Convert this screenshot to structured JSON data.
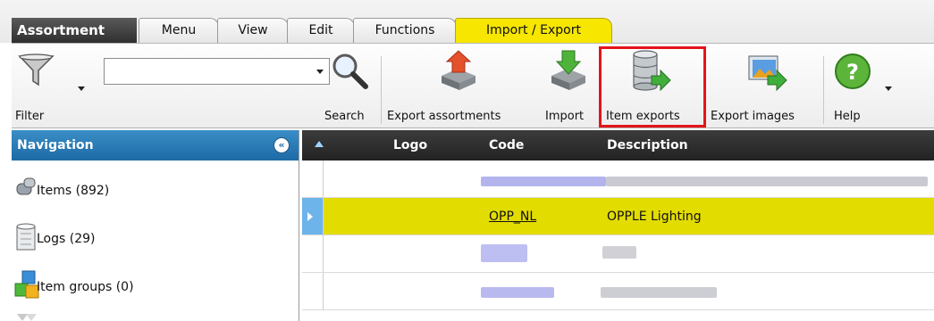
{
  "app_title": "Assortment",
  "tabs": [
    {
      "label": "Menu"
    },
    {
      "label": "View"
    },
    {
      "label": "Edit"
    },
    {
      "label": "Functions"
    },
    {
      "label": "Import / Export",
      "active": true
    }
  ],
  "ribbon": {
    "filter_label": "Filter",
    "search_value": "",
    "search_label": "Search",
    "export_assortments_label": "Export assortments",
    "import_label": "Import",
    "item_exports_label": "Item exports",
    "export_images_label": "Export images",
    "help_label": "Help"
  },
  "navigation": {
    "title": "Navigation",
    "items": [
      {
        "label": "Items (892)",
        "icon": "items-icon"
      },
      {
        "label": "Logs (29)",
        "icon": "logs-icon"
      },
      {
        "label": "Item groups (0)",
        "icon": "item-groups-icon"
      }
    ]
  },
  "grid": {
    "columns": [
      "Logo",
      "Code",
      "Description"
    ],
    "rows": [
      {
        "code": "",
        "description": ""
      },
      {
        "code": "OPP_NL",
        "description": "OPPLE Lighting",
        "selected": true
      },
      {
        "code": "",
        "description": ""
      },
      {
        "code": "",
        "description": ""
      }
    ]
  },
  "colors": {
    "active_tab": "#f6e600",
    "selected_row": "#e3dc00",
    "highlight": "#e3141c",
    "nav_header": "#1d6aa6"
  }
}
